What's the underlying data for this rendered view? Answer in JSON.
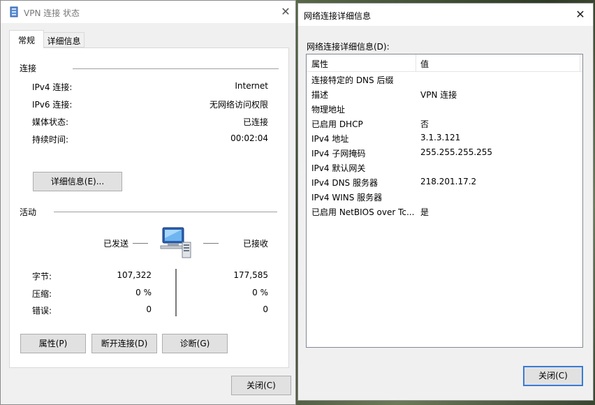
{
  "vpn_status": {
    "title": "VPN 连接 状态",
    "close_glyph": "✕",
    "tabs": [
      "常规",
      "详细信息"
    ],
    "connection": {
      "heading": "连接",
      "rows": [
        {
          "label": "IPv4 连接:",
          "value": "Internet"
        },
        {
          "label": "IPv6 连接:",
          "value": "无网络访问权限"
        },
        {
          "label": "媒体状态:",
          "value": "已连接"
        },
        {
          "label": "持续时间:",
          "value": "00:02:04"
        }
      ],
      "details_button": "详细信息(E)..."
    },
    "activity": {
      "heading": "活动",
      "sent_label": "已发送",
      "received_label": "已接收",
      "rows": [
        {
          "label": "字节:",
          "sent": "107,322",
          "received": "177,585"
        },
        {
          "label": "压缩:",
          "sent": "0 %",
          "received": "0 %"
        },
        {
          "label": "错误:",
          "sent": "0",
          "received": "0"
        }
      ]
    },
    "buttons": {
      "properties": "属性(P)",
      "disconnect": "断开连接(D)",
      "diagnose": "诊断(G)",
      "close": "关闭(C)"
    }
  },
  "details": {
    "title": "网络连接详细信息",
    "close_glyph": "✕",
    "list_label": "网络连接详细信息(D):",
    "columns": {
      "property": "属性",
      "value": "值"
    },
    "rows": [
      {
        "property": "连接特定的 DNS 后缀",
        "value": ""
      },
      {
        "property": "描述",
        "value": "VPN 连接"
      },
      {
        "property": "物理地址",
        "value": ""
      },
      {
        "property": "已启用 DHCP",
        "value": "否"
      },
      {
        "property": "IPv4 地址",
        "value": "3.1.3.121"
      },
      {
        "property": "IPv4 子网掩码",
        "value": "255.255.255.255"
      },
      {
        "property": "IPv4 默认网关",
        "value": ""
      },
      {
        "property": "IPv4 DNS 服务器",
        "value": "218.201.17.2"
      },
      {
        "property": "IPv4 WINS 服务器",
        "value": ""
      },
      {
        "property": "已启用 NetBIOS over Tc...",
        "value": "是"
      }
    ],
    "close_button": "关闭(C)"
  },
  "icons": {
    "app_icon": "network-adapter-icon",
    "activity_icon": "networked-computers-icon"
  },
  "colors": {
    "primary_button_border": "#3a7bd5",
    "window_bg": "#f0f0f0"
  }
}
